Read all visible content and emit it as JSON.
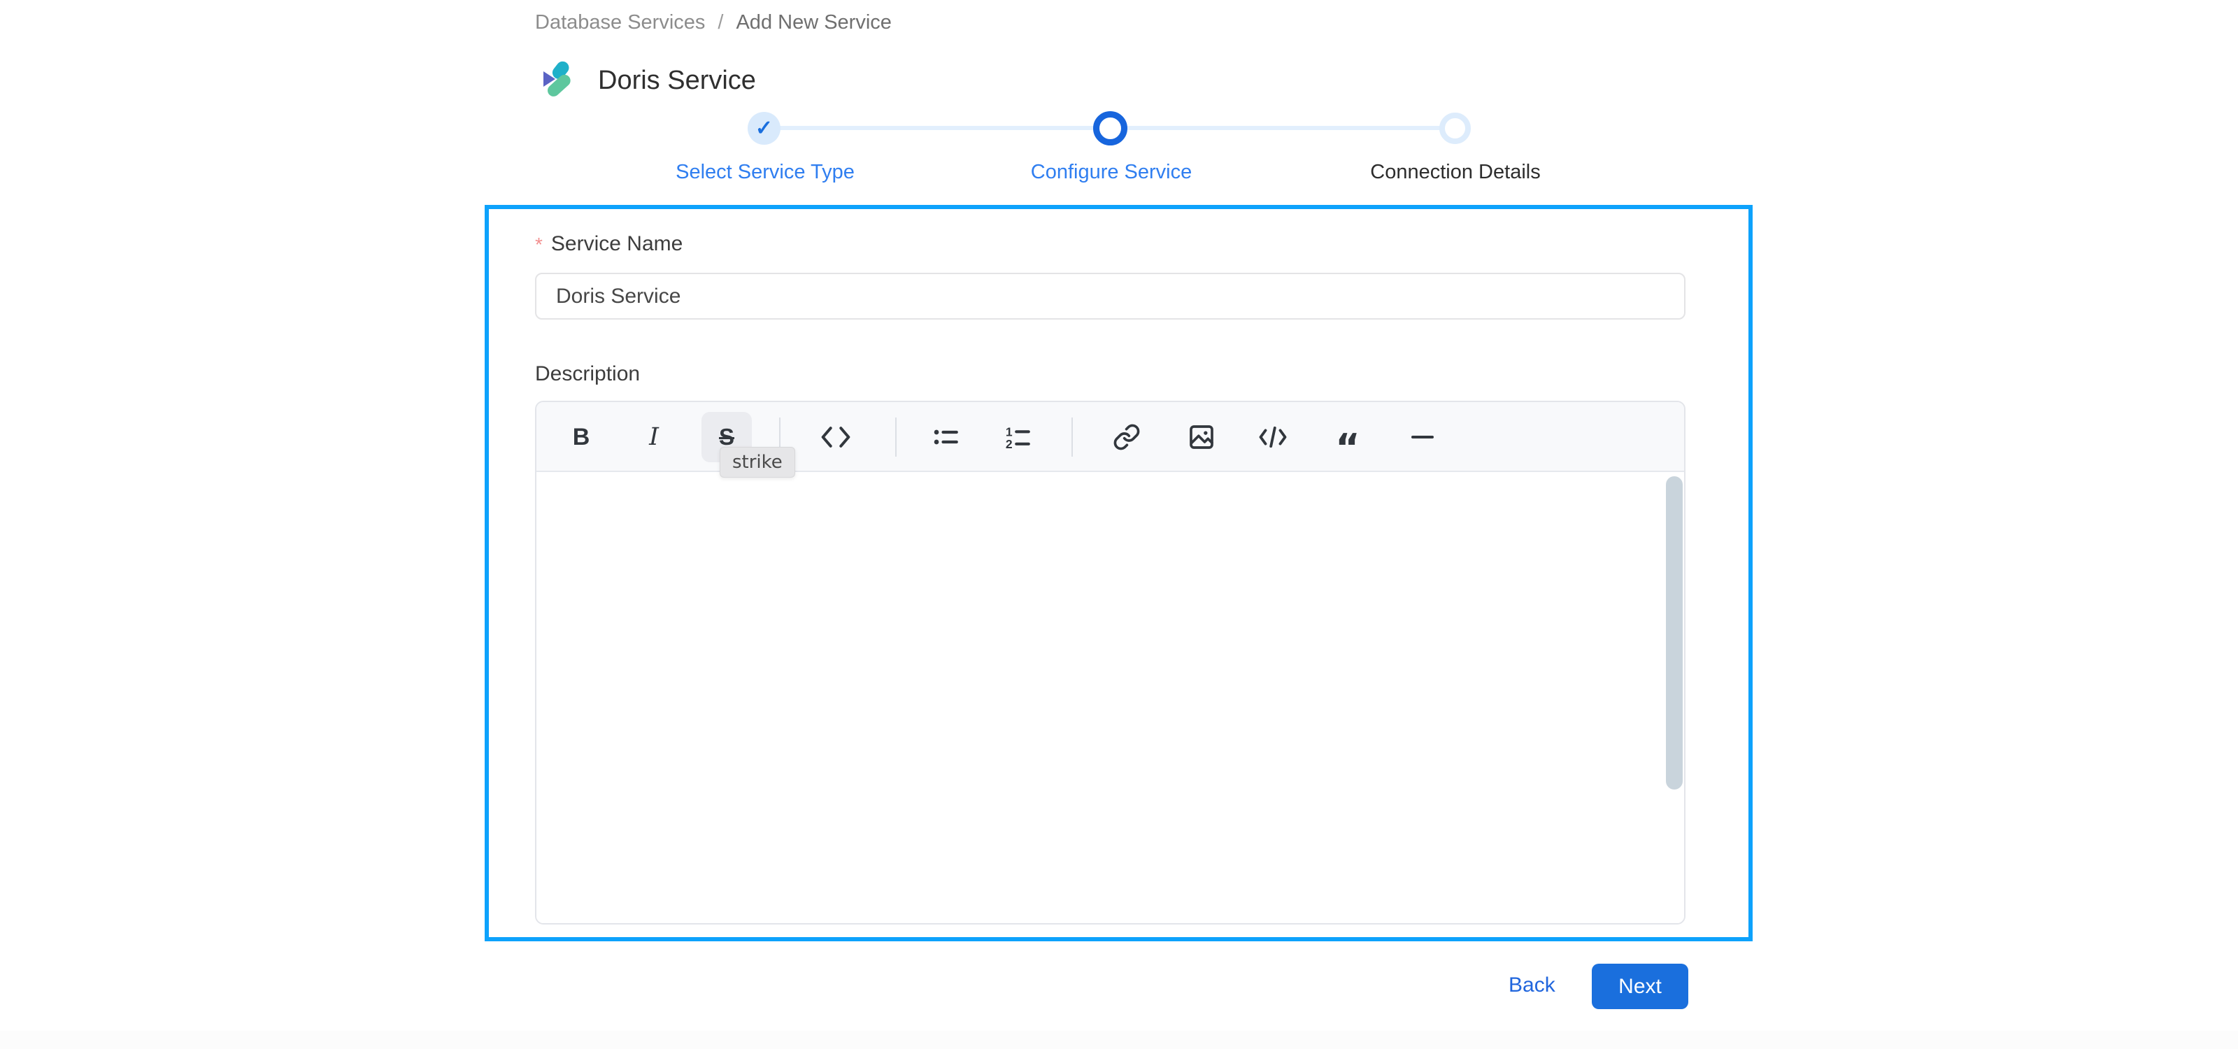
{
  "breadcrumb": {
    "items": [
      {
        "label": "Database Services"
      },
      {
        "label": "Add New Service"
      }
    ],
    "separator": "/"
  },
  "header": {
    "title": "Doris Service",
    "logo": "doris-logo"
  },
  "stepper": {
    "check_glyph": "✓",
    "steps": [
      {
        "label": "Select Service Type",
        "state": "completed"
      },
      {
        "label": "Configure Service",
        "state": "active"
      },
      {
        "label": "Connection Details",
        "state": "upcoming"
      }
    ]
  },
  "form": {
    "service_name": {
      "label": "Service Name",
      "required_marker": "*",
      "value": "Doris Service"
    },
    "description": {
      "label": "Description"
    }
  },
  "editor": {
    "toolbar": {
      "buttons": [
        {
          "name": "bold",
          "glyph": "B"
        },
        {
          "name": "italic",
          "glyph": "I"
        },
        {
          "name": "strikethrough",
          "glyph": "S"
        },
        {
          "name": "inline-code"
        },
        {
          "name": "bullet-list"
        },
        {
          "name": "ordered-list"
        },
        {
          "name": "link"
        },
        {
          "name": "image"
        },
        {
          "name": "code-block"
        },
        {
          "name": "blockquote",
          "glyph": "“"
        },
        {
          "name": "horizontal-rule"
        }
      ],
      "ordered_list_digits": {
        "first": "1",
        "second": "2"
      },
      "tooltip": {
        "text": "strike",
        "for": "strikethrough"
      }
    },
    "content": ""
  },
  "actions": {
    "back_label": "Back",
    "next_label": "Next"
  },
  "colors": {
    "accent_blue": "#1a6fde",
    "step_label_blue": "#2f7ef0",
    "panel_border_blue": "#0da2fc",
    "step_completed_bg": "#d9eafc",
    "step_upcoming_ring": "#ddecfc",
    "toolbar_bg": "#f8f9fb",
    "tooltip_bg": "#e6e6e8",
    "scrollbar_thumb": "#c9d4dc",
    "required_marker_red": "#f28f8f",
    "breadcrumb_gray": "#8c8c8c",
    "logo_teal": "#1fb0c9",
    "logo_indigo": "#5a63c4",
    "logo_green": "#5ec79e"
  }
}
